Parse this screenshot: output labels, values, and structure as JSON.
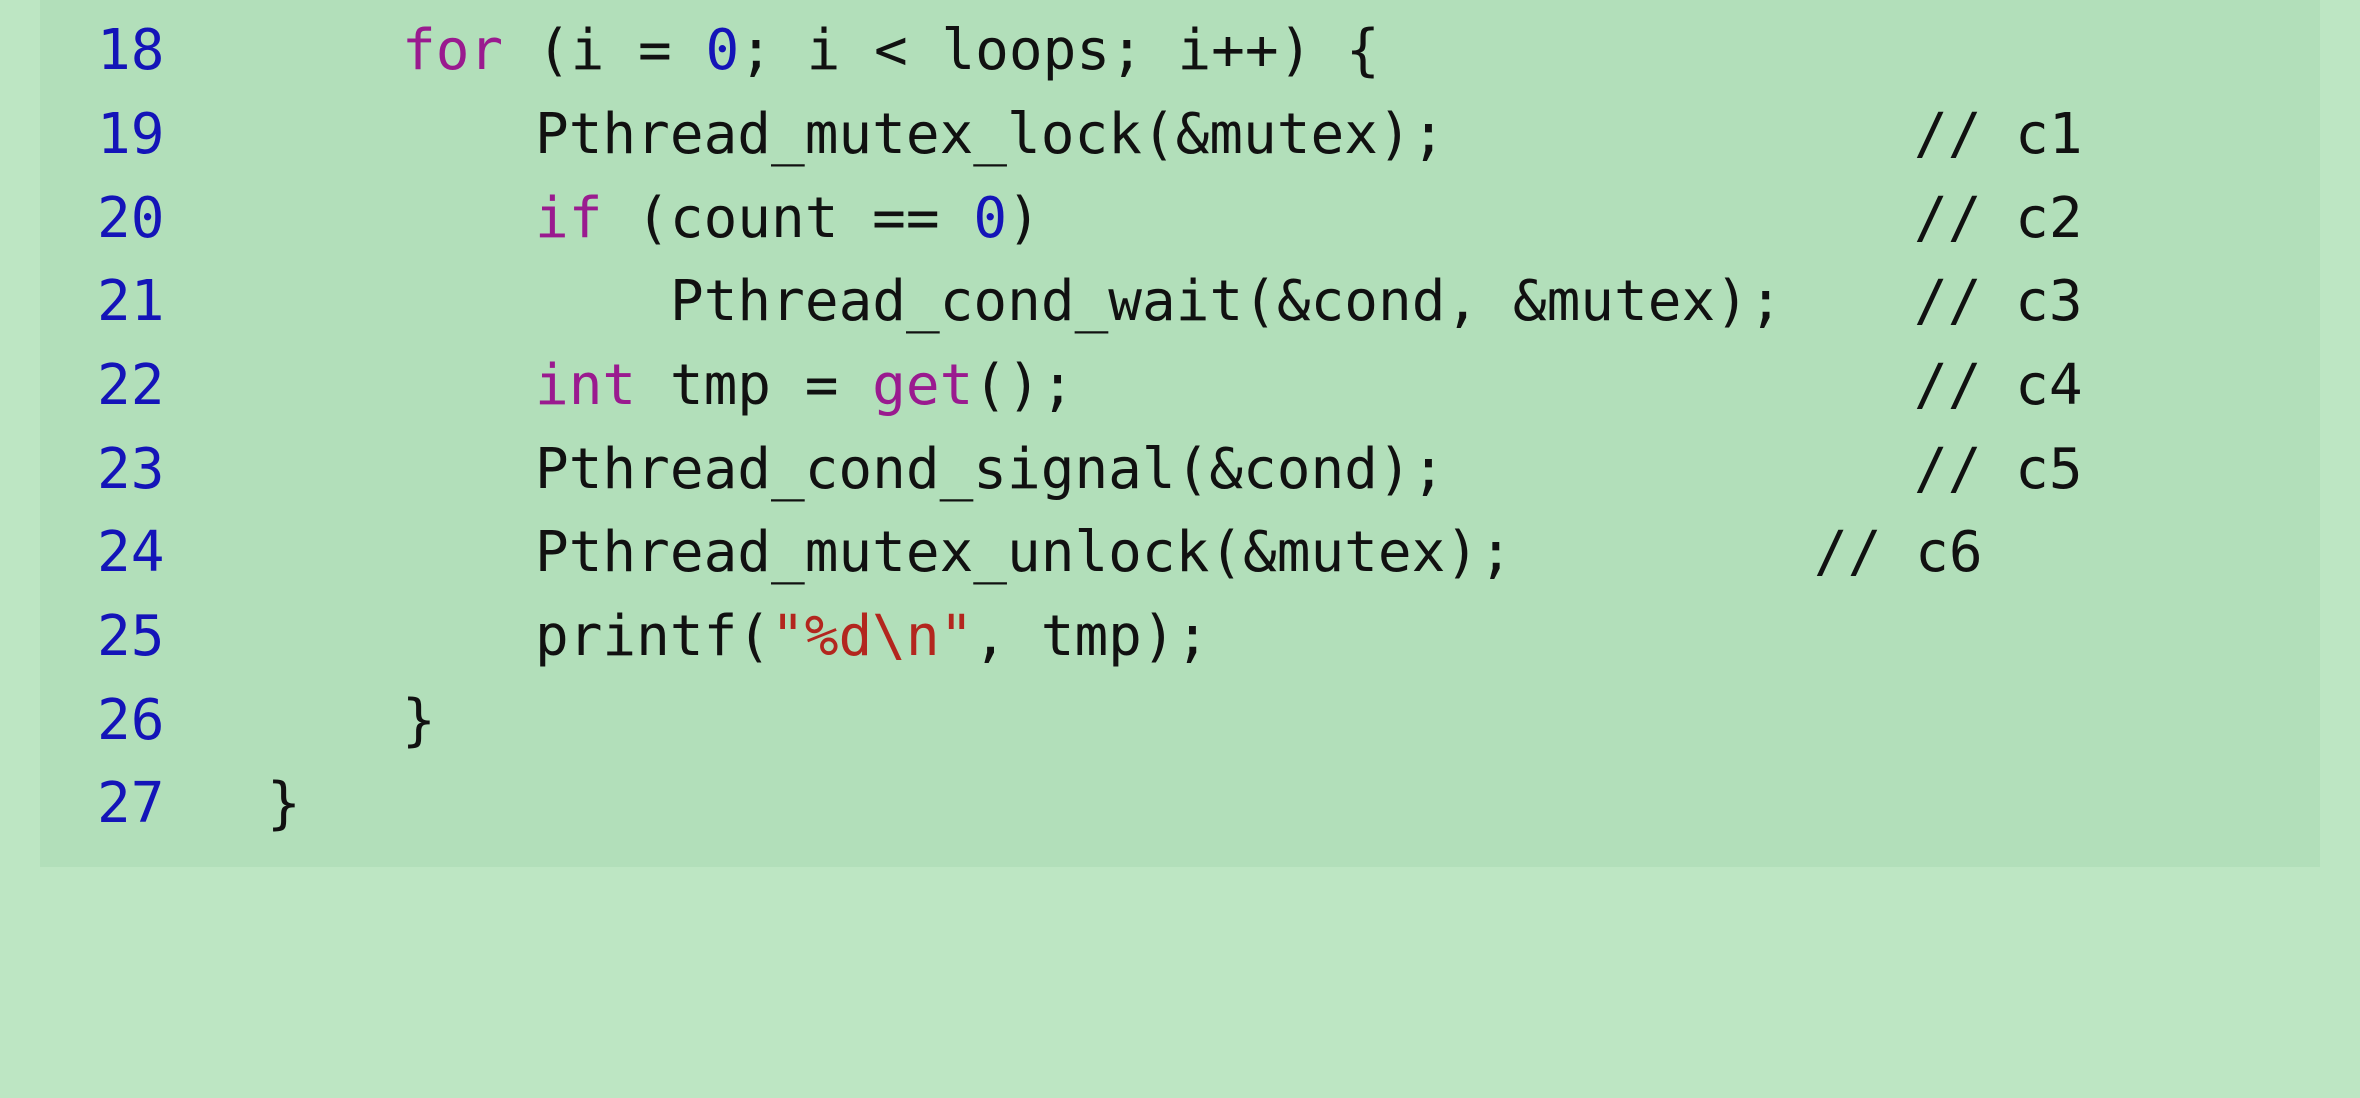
{
  "lines": [
    {
      "number": "18",
      "tokens": [
        {
          "text": "for",
          "type": "keyword"
        },
        {
          "text": " (i = ",
          "type": "plain"
        },
        {
          "text": "0",
          "type": "number"
        },
        {
          "text": "; i < loops; i++) {",
          "type": "plain"
        }
      ],
      "comment": ""
    },
    {
      "number": "19",
      "tokens": [
        {
          "text": "Pthread_mutex_lock(&mutex);",
          "type": "plain"
        }
      ],
      "comment": "// c1"
    },
    {
      "number": "20",
      "tokens": [
        {
          "text": "if",
          "type": "keyword"
        },
        {
          "text": " (count == ",
          "type": "plain"
        },
        {
          "text": "0",
          "type": "number"
        },
        {
          "text": ")",
          "type": "plain"
        }
      ],
      "comment": "// c2"
    },
    {
      "number": "21",
      "tokens": [
        {
          "text": "Pthread_cond_wait(&cond, &mutex);",
          "type": "plain"
        }
      ],
      "comment": "// c3"
    },
    {
      "number": "22",
      "tokens": [
        {
          "text": "int",
          "type": "keyword"
        },
        {
          "text": " tmp = ",
          "type": "plain"
        },
        {
          "text": "get",
          "type": "keyword"
        },
        {
          "text": "();",
          "type": "plain"
        }
      ],
      "comment": "// c4"
    },
    {
      "number": "23",
      "tokens": [
        {
          "text": "Pthread_cond_signal(&cond);",
          "type": "plain"
        }
      ],
      "comment": "// c5"
    },
    {
      "number": "24",
      "tokens": [
        {
          "text": "Pthread_mutex_unlock(&mutex);",
          "type": "plain"
        }
      ],
      "comment": "// c6"
    },
    {
      "number": "25",
      "tokens": [
        {
          "text": "printf(",
          "type": "plain"
        },
        {
          "text": "\"%d\\n\"",
          "type": "string"
        },
        {
          "text": ", tmp);",
          "type": "plain"
        }
      ],
      "comment": ""
    },
    {
      "number": "26",
      "tokens": [
        {
          "text": "}",
          "type": "plain"
        }
      ],
      "comment": ""
    },
    {
      "number": "27",
      "tokens": [
        {
          "text": "}",
          "type": "plain"
        }
      ],
      "comment": ""
    }
  ],
  "colors": {
    "page_background": "#bde6c3",
    "code_background": "#b2dfba",
    "line_number": "#1414b8",
    "keyword": "#9a1a8f",
    "number_literal": "#1414b8",
    "string_literal": "#b3261e",
    "plain_text": "#111111"
  }
}
